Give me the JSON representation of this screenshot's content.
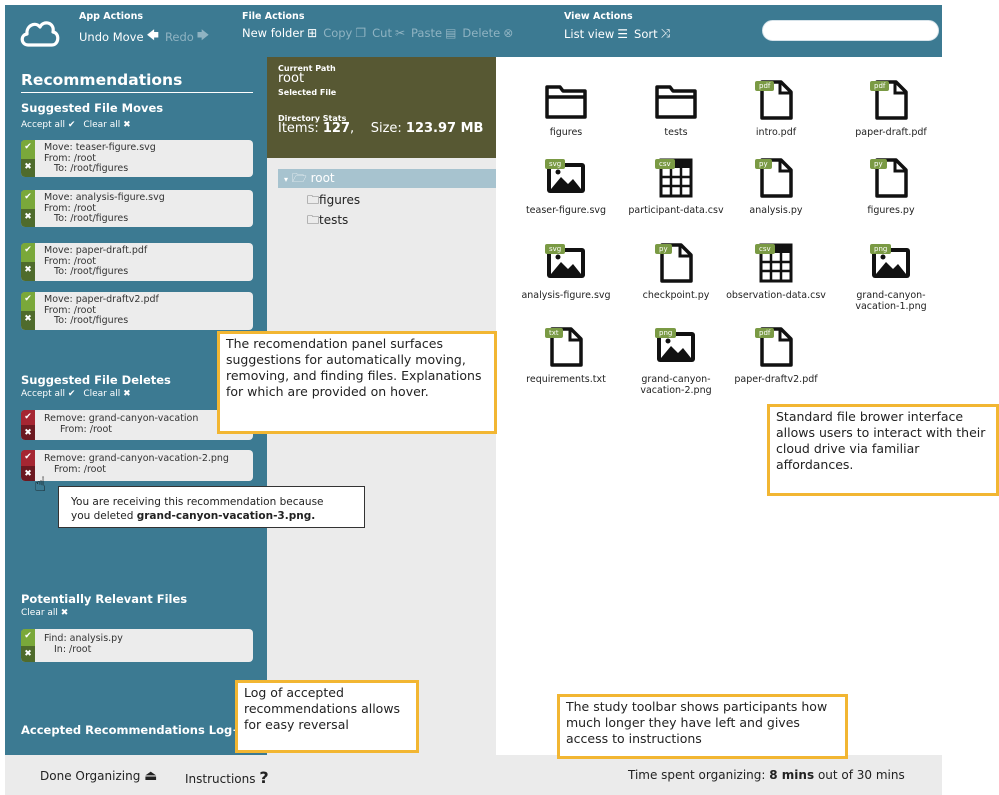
{
  "toolbar": {
    "app_actions_title": "App Actions",
    "undo_label": "Undo Move",
    "redo_label": "Redo",
    "file_actions_title": "File Actions",
    "new_folder_label": "New folder",
    "copy_label": "Copy",
    "cut_label": "Cut",
    "paste_label": "Paste",
    "delete_label": "Delete",
    "view_actions_title": "View Actions",
    "list_view_label": "List view",
    "sort_label": "Sort"
  },
  "recommendations": {
    "title": "Recommendations",
    "moves_title": "Suggested File Moves",
    "accept_all": "Accept all ✔",
    "clear_all": "Clear all ✖",
    "moves": [
      {
        "line1": "Move: teaser-figure.svg",
        "line2": "From: /root",
        "line3": "To: /root/figures"
      },
      {
        "line1": "Move: analysis-figure.svg",
        "line2": "From: /root",
        "line3": "To: /root/figures"
      },
      {
        "line1": "Move: paper-draft.pdf",
        "line2": "From: /root",
        "line3": "To: /root/figures"
      },
      {
        "line1": "Move: paper-draftv2.pdf",
        "line2": "From: /root",
        "line3": "To: /root/figures"
      }
    ],
    "deletes_title": "Suggested File Deletes",
    "deletes": [
      {
        "line1": "Remove: grand-canyon-vacation",
        "line2": "From: /root"
      },
      {
        "line1": "Remove: grand-canyon-vacation-2.png",
        "line2": "From: /root"
      }
    ],
    "tooltip_text": "You are receiving this recommendation because",
    "tooltip_text2": "you deleted",
    "tooltip_bold": "grand-canyon-vacation-3.png.",
    "relevant_title": "Potentially Relevant Files",
    "finds": [
      {
        "line1": "Find: analysis.py",
        "line2": "In: /root"
      }
    ],
    "log_title": "Accepted Recommendations Log+"
  },
  "stats": {
    "current_path_label": "Current Path",
    "current_path": "root",
    "selected_file_label": "Selected File",
    "dir_stats_label": "Directory Stats",
    "items_label": "Items:",
    "items_value": "127",
    "size_label": "Size:",
    "size_value": "123.97 MB"
  },
  "tree": {
    "root": "root",
    "children": [
      "figures",
      "tests"
    ]
  },
  "files": [
    {
      "name": "figures",
      "type": "folder",
      "badge": ""
    },
    {
      "name": "tests",
      "type": "folder",
      "badge": ""
    },
    {
      "name": "intro.pdf",
      "type": "doc",
      "badge": "pdf"
    },
    {
      "name": "paper-draft.pdf",
      "type": "doc",
      "badge": "pdf"
    },
    {
      "name": "teaser-figure.svg",
      "type": "image",
      "badge": "svg"
    },
    {
      "name": "participant-data.csv",
      "type": "grid",
      "badge": "csv"
    },
    {
      "name": "analysis.py",
      "type": "doc",
      "badge": "py"
    },
    {
      "name": "figures.py",
      "type": "doc",
      "badge": "py"
    },
    {
      "name": "analysis-figure.svg",
      "type": "image",
      "badge": "svg"
    },
    {
      "name": "checkpoint.py",
      "type": "doc",
      "badge": "py"
    },
    {
      "name": "observation-data.csv",
      "type": "grid",
      "badge": "csv"
    },
    {
      "name": "grand-canyon-vacation-1.png",
      "type": "image",
      "badge": "png"
    },
    {
      "name": "requirements.txt",
      "type": "doc",
      "badge": "txt"
    },
    {
      "name": "grand-canyon-vacation-2.png",
      "type": "image",
      "badge": "png"
    },
    {
      "name": "paper-draftv2.pdf",
      "type": "doc",
      "badge": "pdf"
    }
  ],
  "bottom": {
    "done_label": "Done Organizing",
    "instructions_label": "Instructions",
    "time_label": "Time spent organizing:",
    "time_value": "8 mins",
    "time_total": "out of 30 mins"
  },
  "callouts": {
    "panel": "The recomendation panel surfaces suggestions for automatically moving, removing, and finding files. Explanations for which are provided on hover.",
    "browser": "Standard file brower interface allows users to interact with their cloud drive via familiar affordances.",
    "log": "Log of accepted recommendations allows for easy reversal",
    "toolbar": "The study toolbar shows participants how much longer they have left and gives access to instructions"
  },
  "colors": {
    "primary": "#3c7a92",
    "stats_bg": "#575833",
    "accept_green": "#7aa83a",
    "delete_red": "#a52632",
    "callout_border": "#f2b632"
  }
}
